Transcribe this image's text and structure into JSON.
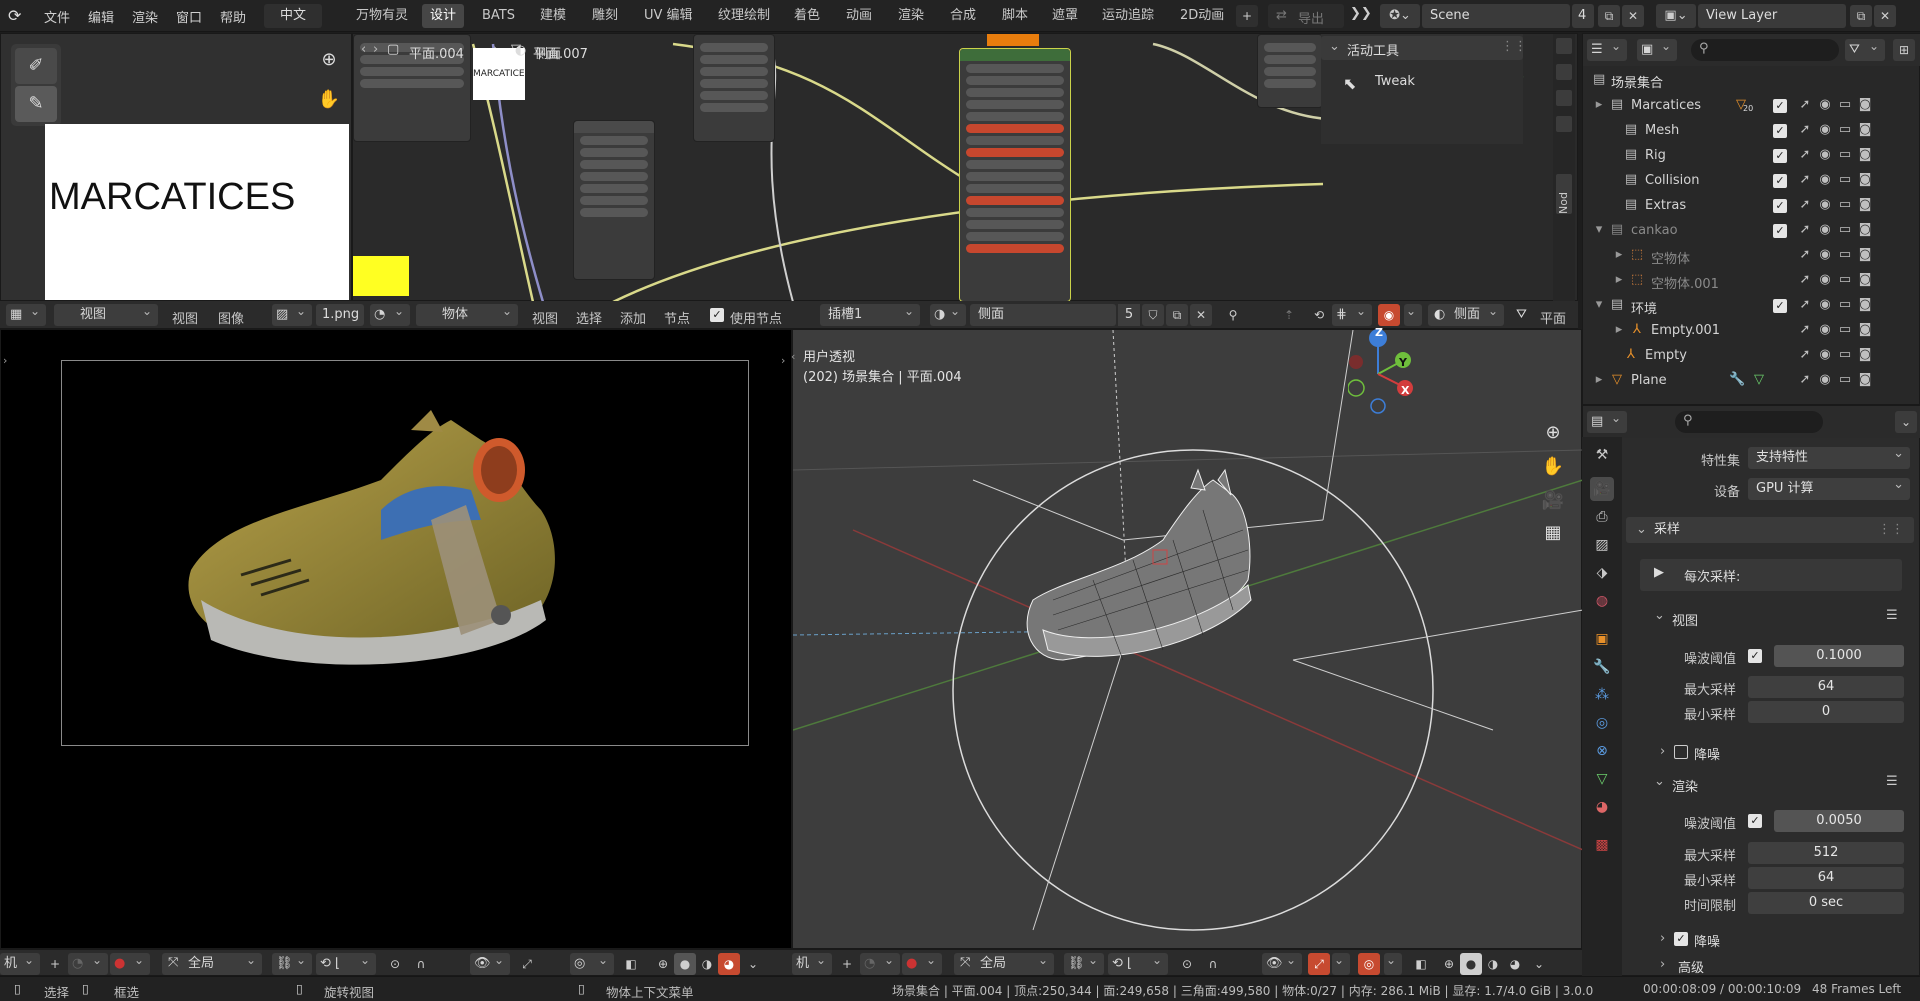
{
  "topbar": {
    "menus": [
      "文件",
      "编辑",
      "渲染",
      "窗口",
      "帮助"
    ],
    "language": "中文",
    "workspaces": [
      "万物有灵",
      "设计",
      "BATS",
      "建模",
      "雕刻",
      "UV 编辑",
      "纹理绘制",
      "着色",
      "动画",
      "渲染",
      "合成",
      "脚本",
      "遮罩",
      "运动追踪",
      "2D动画"
    ],
    "active_workspace": "设计",
    "export_label": "导出",
    "scene_name": "Scene",
    "scene_users": "4",
    "view_layer": "View Layer"
  },
  "image_editor": {
    "text": "MARCATICES",
    "header": {
      "view_dd": "视图",
      "menus": [
        "视图",
        "图像"
      ],
      "image_name": "1.png"
    }
  },
  "node_editor": {
    "breadcrumb": [
      "平面.004",
      "平面.007",
      "侧面"
    ],
    "header": {
      "object_dd": "物体",
      "menus": [
        "视图",
        "选择",
        "添加",
        "节点"
      ],
      "use_nodes": "使用节点",
      "slot": "插槽1",
      "material": "侧面",
      "users": "5",
      "plane_label": "平面"
    },
    "sidebar_tab": "Nod",
    "thumb_text": "MARCATICES"
  },
  "active_tool": {
    "title": "活动工具",
    "tool": "Tweak"
  },
  "outliner": {
    "root": "场景集合",
    "rows": [
      {
        "label": "Marcatices",
        "badge": "20"
      },
      {
        "label": "Mesh"
      },
      {
        "label": "Rig"
      },
      {
        "label": "Collision"
      },
      {
        "label": "Extras"
      },
      {
        "label": "cankao"
      },
      {
        "label": "空物体"
      },
      {
        "label": "空物体.001"
      },
      {
        "label": "环境"
      },
      {
        "label": "Empty.001"
      },
      {
        "label": "Empty"
      },
      {
        "label": "Plane"
      }
    ]
  },
  "viewport": {
    "mode_label": "用户透视",
    "info": "(202) 场景集合 | 平面.004",
    "gizmo": {
      "z": "Z",
      "y": "Y",
      "x": "X"
    }
  },
  "render_footer": {
    "mode": "机",
    "transform": "全局"
  },
  "viewport_footer": {
    "mode": "机",
    "transform": "全局"
  },
  "properties": {
    "feature_set_label": "特性集",
    "feature_set": "支持特性",
    "device_label": "设备",
    "device": "GPU 计算",
    "sampling": "采样",
    "per_sample": "每次采样:",
    "viewport_section": "视图",
    "noise_threshold_label": "噪波阈值",
    "vp_noise": "0.1000",
    "max_samples_label": "最大采样",
    "vp_max": "64",
    "min_samples_label": "最小采样",
    "vp_min": "0",
    "denoise_label": "降噪",
    "render_section": "渲染",
    "r_noise": "0.0050",
    "r_max": "512",
    "r_min": "64",
    "time_limit_label": "时间限制",
    "r_time": "0 sec",
    "advanced": "高级"
  },
  "status": {
    "select": "选择",
    "box_select": "框选",
    "rotate": "旋转视图",
    "context_menu": "物体上下文菜单",
    "stats": "场景集合 | 平面.004 | 顶点:250,344 | 面:249,658 | 三角面:499,580 | 物体:0/27 | 内存: 286.1 MiB | 显存: 1.7/4.0 GiB | 3.0.0",
    "time": "00:00:08:09 / 00:00:10:09",
    "frames": "48 Frames Left"
  },
  "colors": {
    "accent": "#e87d0d",
    "yellow": "#ffff22",
    "active_tab": "#464646"
  }
}
